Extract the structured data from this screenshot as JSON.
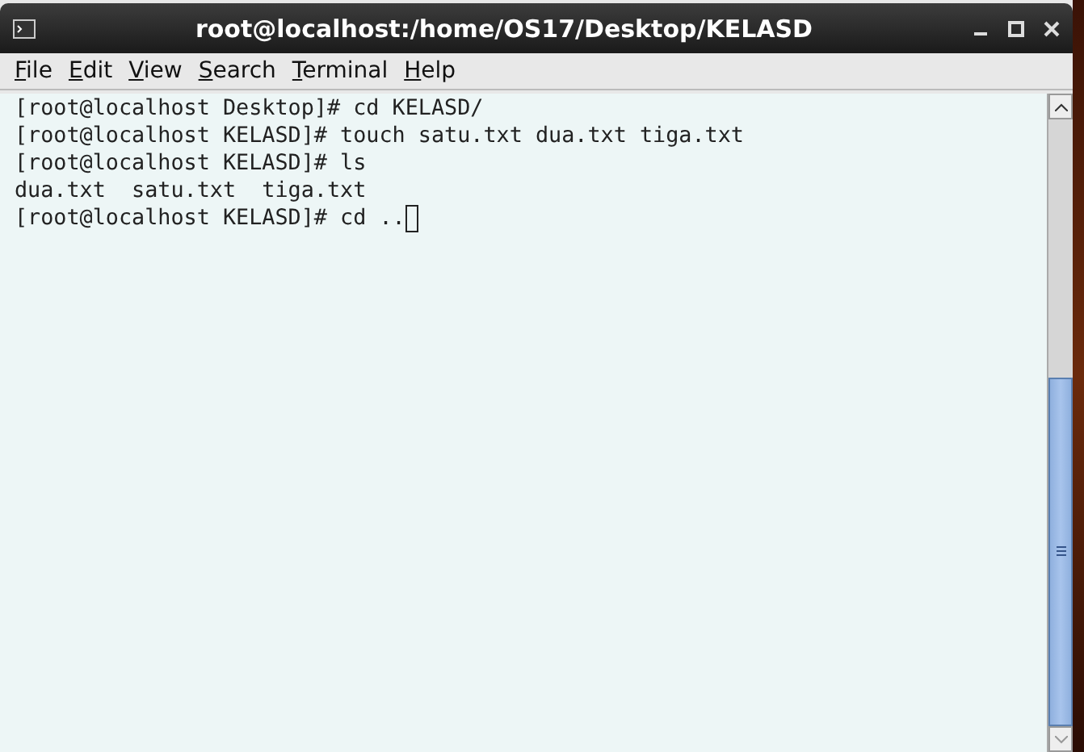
{
  "window": {
    "title": "root@localhost:/home/OS17/Desktop/KELASD"
  },
  "menu": [
    {
      "label": "File"
    },
    {
      "label": "Edit"
    },
    {
      "label": "View"
    },
    {
      "label": "Search"
    },
    {
      "label": "Terminal"
    },
    {
      "label": "Help"
    }
  ],
  "terminal": {
    "lines": [
      "[root@localhost Desktop]# cd KELASD/",
      "[root@localhost KELASD]# touch satu.txt dua.txt tiga.txt",
      "[root@localhost KELASD]# ls",
      "dua.txt  satu.txt  tiga.txt"
    ],
    "prompt": "[root@localhost KELASD]# cd .."
  }
}
